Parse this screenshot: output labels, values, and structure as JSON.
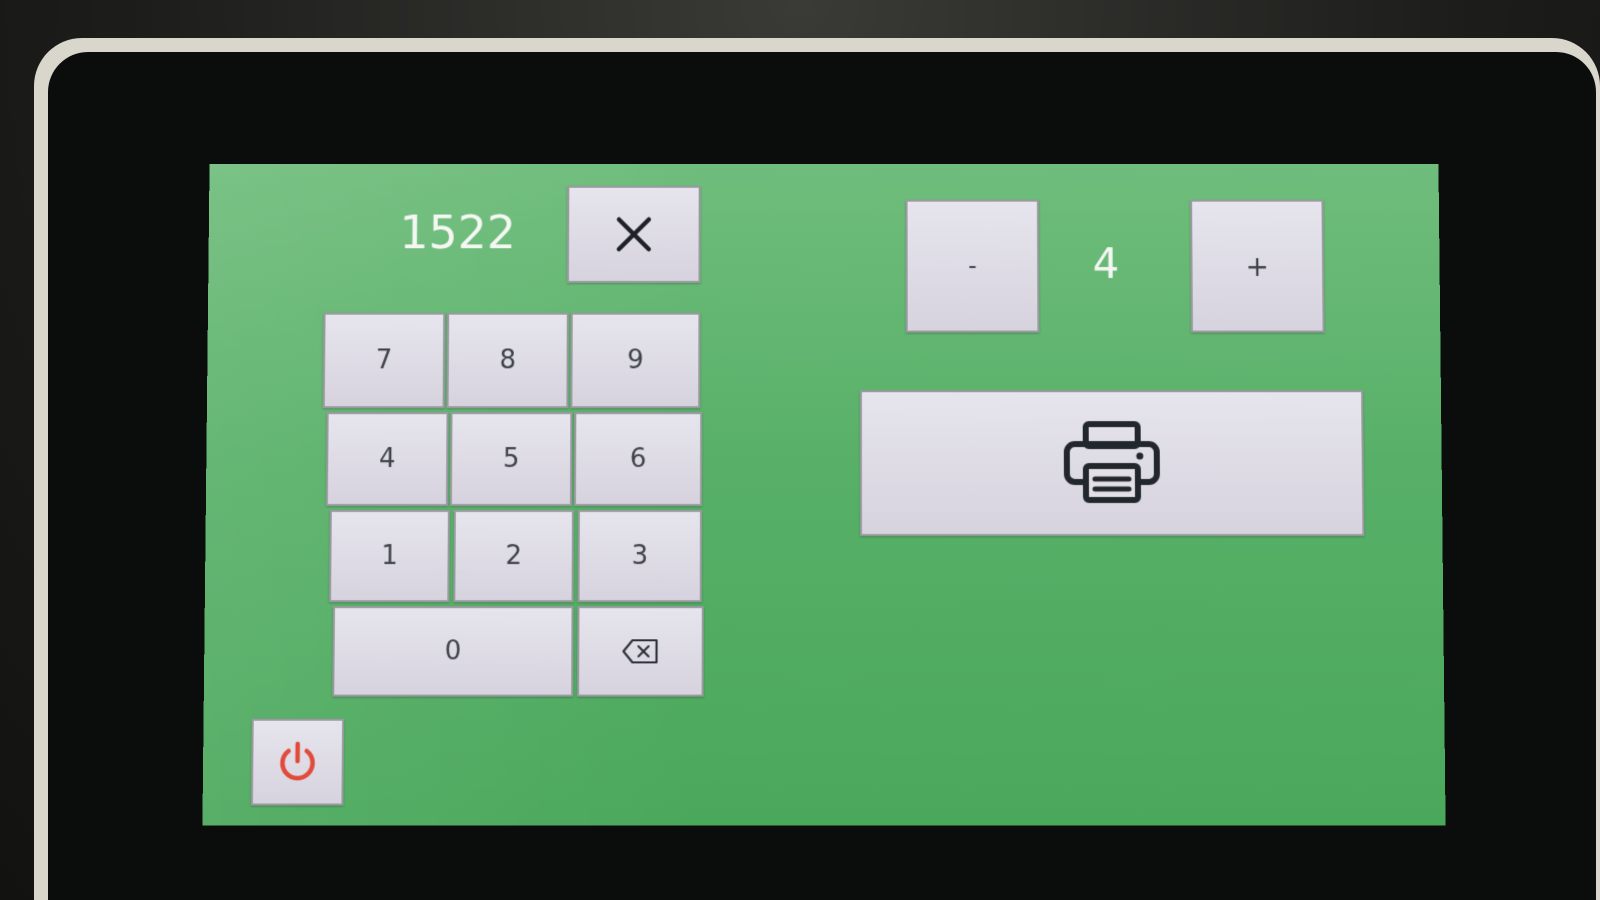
{
  "display": {
    "value": "1522"
  },
  "keypad": {
    "keys": [
      "7",
      "8",
      "9",
      "4",
      "5",
      "6",
      "1",
      "2",
      "3",
      "0"
    ],
    "clear_icon": "close-icon",
    "backspace_icon": "backspace-icon"
  },
  "quantity": {
    "minus_label": "-",
    "value": "4",
    "plus_label": "+"
  },
  "print": {
    "icon": "printer-icon"
  },
  "power": {
    "icon": "power-icon",
    "color": "#e24a3b"
  },
  "colors": {
    "screen_green": "#58b068",
    "button_bg": "#dedbe4",
    "text": "#3f4448"
  }
}
